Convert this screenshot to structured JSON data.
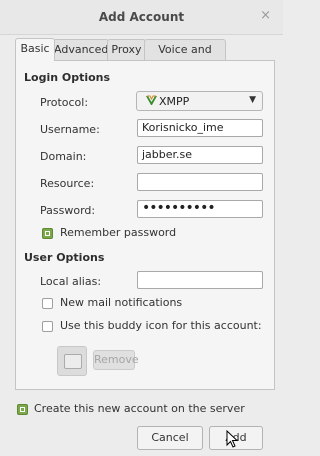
{
  "window": {
    "title": "Add Account",
    "close_icon": "×"
  },
  "tabs": [
    {
      "label": "Basic"
    },
    {
      "label": "Advanced"
    },
    {
      "label": "Proxy"
    },
    {
      "label": "Voice and Video"
    }
  ],
  "login_options": {
    "heading": "Login Options",
    "protocol": {
      "label": "Protocol:",
      "value": "XMPP",
      "icon": "xmpp-icon"
    },
    "username": {
      "label": "Username:",
      "value": "Korisnicko_ime"
    },
    "domain": {
      "label": "Domain:",
      "value": "jabber.se"
    },
    "resource": {
      "label": "Resource:",
      "value": ""
    },
    "password": {
      "label": "Password:",
      "value": "••••••••••"
    },
    "remember_password": {
      "label": "Remember password",
      "checked": true
    }
  },
  "user_options": {
    "heading": "User Options",
    "local_alias": {
      "label": "Local alias:",
      "value": ""
    },
    "new_mail": {
      "label": "New mail notifications",
      "checked": false
    },
    "buddy_icon": {
      "label": "Use this buddy icon for this account:",
      "checked": false
    },
    "remove_label": "Remove"
  },
  "footer": {
    "create_on_server": {
      "label": "Create this new account on the server",
      "checked": true
    },
    "cancel_label": "Cancel",
    "add_label": "Add"
  },
  "colors": {
    "check_on": "#7ba84a",
    "xmpp_icon": "#3a8d2e"
  }
}
